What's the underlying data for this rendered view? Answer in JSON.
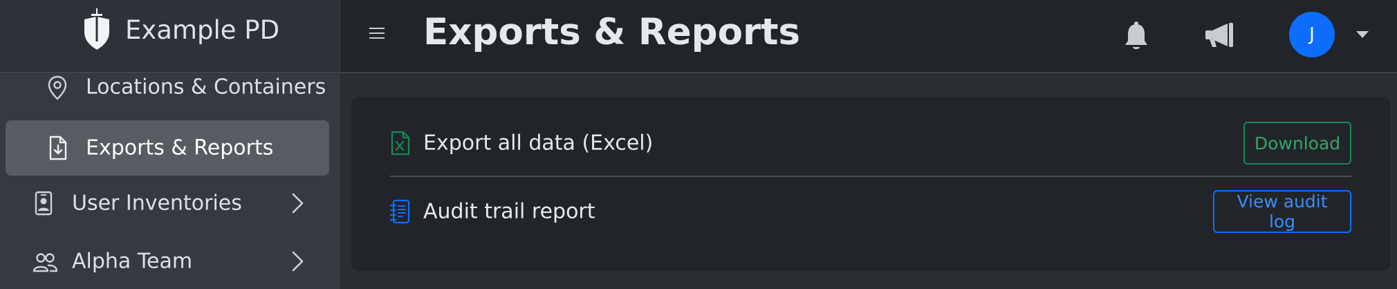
{
  "brand": {
    "name": "Example PD",
    "logo_icon": "shield-sword-icon"
  },
  "sidebar": {
    "items": [
      {
        "label": "Locations & Containers",
        "icon": "map-pin-icon",
        "active": false,
        "has_submenu": false
      },
      {
        "label": "Exports & Reports",
        "icon": "file-download-icon",
        "active": true,
        "has_submenu": false
      },
      {
        "label": "User Inventories",
        "icon": "person-badge-icon",
        "active": false,
        "has_submenu": true
      },
      {
        "label": "Alpha Team",
        "icon": "people-icon",
        "active": false,
        "has_submenu": true
      }
    ]
  },
  "header": {
    "title": "Exports & Reports",
    "user_initial": "J",
    "avatar_color": "#0d6efd"
  },
  "main": {
    "rows": [
      {
        "label": "Export all data (Excel)",
        "icon": "file-excel-icon",
        "icon_color": "#198754",
        "button_label": "Download",
        "button_color": "#198754"
      },
      {
        "label": "Audit trail report",
        "icon": "journal-text-icon",
        "icon_color": "#0d6efd",
        "button_label": "View audit log",
        "button_color": "#0d6efd"
      }
    ]
  },
  "colors": {
    "sidebar_bg": "#343a40",
    "topbar_bg": "#212529",
    "active_item_bg": "#575c62",
    "success": "#198754",
    "primary": "#0d6efd"
  }
}
